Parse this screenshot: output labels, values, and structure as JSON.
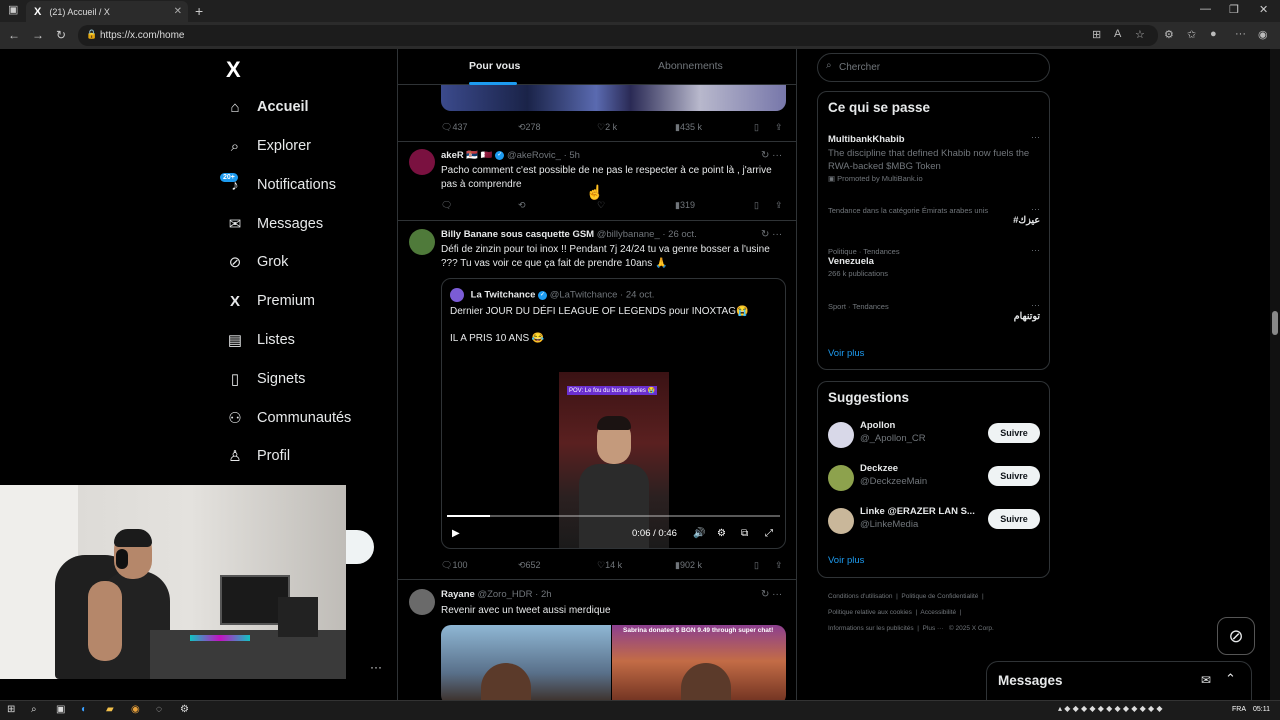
{
  "browser": {
    "tab_title": "(21) Accueil / X",
    "tab_logo": "X",
    "new_tab": "+",
    "url": "https://x.com/home",
    "controls": {
      "minimize": "—",
      "maximize": "❐",
      "close": "✕"
    }
  },
  "sidebar": {
    "logo": "X",
    "items": [
      {
        "label": "Accueil",
        "icon": "home-icon",
        "glyph": "⌂",
        "active": true
      },
      {
        "label": "Explorer",
        "icon": "search-icon",
        "glyph": "⌕"
      },
      {
        "label": "Notifications",
        "icon": "bell-icon",
        "glyph": "♪",
        "badge": "20+"
      },
      {
        "label": "Messages",
        "icon": "mail-icon",
        "glyph": "✉"
      },
      {
        "label": "Grok",
        "icon": "grok-icon",
        "glyph": "⊘"
      },
      {
        "label": "Premium",
        "icon": "x-icon",
        "glyph": "X"
      },
      {
        "label": "Listes",
        "icon": "list-icon",
        "glyph": "▤"
      },
      {
        "label": "Signets",
        "icon": "bookmark-icon",
        "glyph": "▯"
      },
      {
        "label": "Communautés",
        "icon": "people-icon",
        "glyph": "⚇"
      },
      {
        "label": "Profil",
        "icon": "person-icon",
        "glyph": "♙"
      }
    ]
  },
  "feed": {
    "tabs": [
      "Pour vous",
      "Abonnements"
    ],
    "tweet0_actions": {
      "replies": "437",
      "retweets": "278",
      "likes": "2 k",
      "views": "435 k"
    },
    "tweet1": {
      "name": "akeR 🇷🇸 🇶🇦",
      "handle": "@akeRovic_ · 5h",
      "text": "Pacho comment c'est possible de ne pas le respecter à ce point là , j'arrive pas à comprendre",
      "views": "319"
    },
    "tweet2": {
      "name": "Billy Banane sous casquette GSM",
      "handle": "@billybanane_ · 26 oct.",
      "text": "Défi de zinzin pour toi inox !! Pendant 7j 24/24 tu va genre bosser a l'usine ??? Tu vas voir ce que ça fait de prendre 10ans 🙏",
      "quote": {
        "name": "La Twitchance",
        "handle": "@LaTwitchance · 24 oct.",
        "line1": "Dernier JOUR DU DÉFI LEAGUE OF LEGENDS pour INOXTAG😭",
        "line2": "IL A PRIS 10 ANS 😂",
        "video_caption": "POV: Le fou du bus te parles 😭",
        "time": "0:06 / 0:46",
        "progress": 0.13
      },
      "replies": "100",
      "retweets": "652",
      "likes": "14 k",
      "views": "902 k"
    },
    "tweet3": {
      "name": "Rayane",
      "handle": "@Zoro_HDR · 2h",
      "text": "Revenir avec un tweet aussi merdique",
      "media_text": "Sabrina donated $ BGN 9.49 through super chat!"
    }
  },
  "right": {
    "search_placeholder": "Chercher",
    "trends_title": "Ce qui se passe",
    "trends": [
      {
        "meta": "",
        "title": "MultibankKhabib",
        "desc": "The discipline that defined Khabib now fuels the RWA-backed $MBG Token",
        "promo": "Promoted by MultiBank.io"
      },
      {
        "meta": "Tendance dans la catégorie Émirats arabes unis",
        "title": "#عيزك",
        "count": ""
      },
      {
        "meta": "Politique · Tendances",
        "title": "Venezuela",
        "count": "266 k publications"
      },
      {
        "meta": "Sport · Tendances",
        "title": "توتنهام",
        "count": ""
      }
    ],
    "see_more": "Voir plus",
    "suggestions_title": "Suggestions",
    "suggestions": [
      {
        "name": "Apollon",
        "handle": "@_Apollon_CR",
        "button": "Suivre"
      },
      {
        "name": "Deckzee",
        "handle": "@DeckzeeMain",
        "button": "Suivre"
      },
      {
        "name": "Linke @ERAZER LAN S...",
        "handle": "@LinkeMedia",
        "button": "Suivre"
      }
    ],
    "footer": [
      "Conditions d'utilisation",
      "Politique de Confidentialité",
      "Politique relative aux cookies",
      "Accessibilité",
      "Informations sur les publicités",
      "Plus ···",
      "© 2025 X Corp."
    ],
    "messages_title": "Messages"
  },
  "taskbar": {
    "lang": "FRA",
    "time": "05:11"
  }
}
